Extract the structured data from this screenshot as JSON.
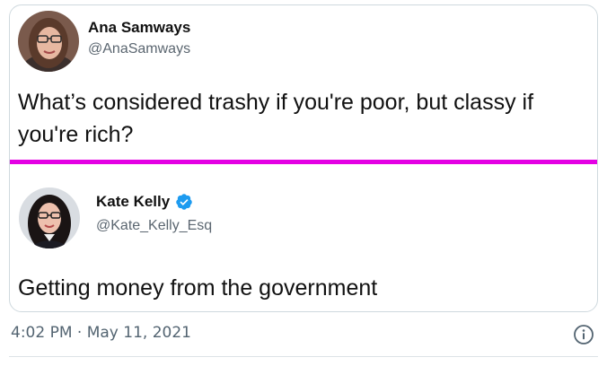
{
  "original_tweet": {
    "name": "Ana Samways",
    "handle": "@AnaSamways",
    "text": "What’s considered trashy if you're poor, but classy if you're rich?"
  },
  "reply_tweet": {
    "name": "Kate Kelly",
    "handle": "@Kate_Kelly_Esq",
    "verified": true,
    "text": "Getting money from the government"
  },
  "footer": {
    "timestamp": "4:02 PM · May 11, 2021",
    "info_icon": "info-circle-icon"
  },
  "colors": {
    "divider": "#e400e4",
    "verified_badge": "#1d9bf0",
    "meta_text": "#536471"
  }
}
